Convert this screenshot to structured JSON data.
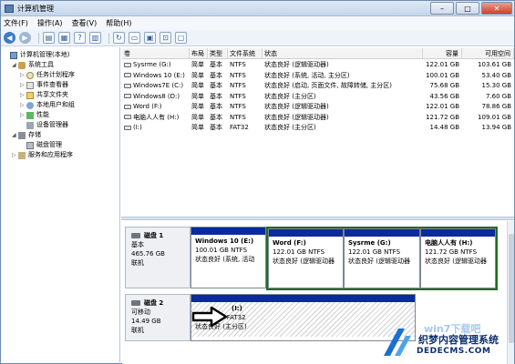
{
  "window": {
    "title": "计算机管理"
  },
  "menu": [
    "文件(F)",
    "操作(A)",
    "查看(V)",
    "帮助(H)"
  ],
  "tree": [
    {
      "label": "计算机管理(本地)",
      "level": 0,
      "exp": "",
      "icon": "computer-icon"
    },
    {
      "label": "系统工具",
      "level": 1,
      "exp": "◢",
      "icon": "tools-icon"
    },
    {
      "label": "任务计划程序",
      "level": 2,
      "exp": "▷",
      "icon": "clock-icon"
    },
    {
      "label": "事件查看器",
      "level": 2,
      "exp": "▷",
      "icon": "event-log-icon"
    },
    {
      "label": "共享文件夹",
      "level": 2,
      "exp": "▷",
      "icon": "shared-folder-icon"
    },
    {
      "label": "本地用户和组",
      "level": 2,
      "exp": "▷",
      "icon": "users-icon"
    },
    {
      "label": "性能",
      "level": 2,
      "exp": "▷",
      "icon": "performance-icon"
    },
    {
      "label": "设备管理器",
      "level": 2,
      "exp": "",
      "icon": "device-manager-icon"
    },
    {
      "label": "存储",
      "level": 1,
      "exp": "◢",
      "icon": "storage-icon"
    },
    {
      "label": "磁盘管理",
      "level": 2,
      "exp": "",
      "icon": "disk-icon"
    },
    {
      "label": "服务和应用程序",
      "level": 1,
      "exp": "▷",
      "icon": "services-icon"
    }
  ],
  "volumes": {
    "headers": [
      "卷",
      "布局",
      "类型",
      "文件系统",
      "状态",
      "容量",
      "可用空间"
    ],
    "rows": [
      [
        "Sysrme (G:)",
        "简单",
        "基本",
        "NTFS",
        "状态良好 (逻辑驱动器)",
        "122.01 GB",
        "103.61 GB"
      ],
      [
        "Windows 10 (E:)",
        "简单",
        "基本",
        "NTFS",
        "状态良好 (系统, 活动, 主分区)",
        "100.01 GB",
        "53.40 GB"
      ],
      [
        "Windows7E (C:)",
        "简单",
        "基本",
        "NTFS",
        "状态良好 (启动, 页面文件, 故障转储, 主分区)",
        "75.68 GB",
        "15.30 GB"
      ],
      [
        "Windows8 (D:)",
        "简单",
        "基本",
        "NTFS",
        "状态良好 (主分区)",
        "43.56 GB",
        "7.60 GB"
      ],
      [
        "Word (F:)",
        "简单",
        "基本",
        "NTFS",
        "状态良好 (逻辑驱动器)",
        "122.01 GB",
        "78.86 GB"
      ],
      [
        "电脑人人有 (H:)",
        "简单",
        "基本",
        "NTFS",
        "状态良好 (逻辑驱动器)",
        "121.72 GB",
        "109.01 GB"
      ],
      [
        "(I:)",
        "简单",
        "基本",
        "FAT32",
        "状态良好 (主分区)",
        "14.48 GB",
        "13.94 GB"
      ]
    ]
  },
  "disk1": {
    "name": "磁盘 1",
    "type": "基本",
    "size": "465.76 GB",
    "status": "联机",
    "partitions": [
      {
        "name": "Windows 10  (E:)",
        "size": "100.01 GB NTFS",
        "status": "状态良好 (系统, 活动"
      },
      {
        "name": "Word  (F:)",
        "size": "122.01 GB NTFS",
        "status": "状态良好 (逻辑驱动器"
      },
      {
        "name": "Sysrme  (G:)",
        "size": "122.01 GB NTFS",
        "status": "状态良好 (逻辑驱动器"
      },
      {
        "name": "电脑人人有  (H:)",
        "size": "121.72 GB NTFS",
        "status": "状态良好 (逻辑驱动器"
      }
    ]
  },
  "disk2": {
    "name": "磁盘 2",
    "type": "可移动",
    "size": "14.49 GB",
    "status": "联机",
    "partition": {
      "name": "(I:)",
      "size": "14.48 GB FAT32",
      "status": "状态良好 (主分区)"
    }
  },
  "watermark": {
    "line1": "织梦内容管理系统",
    "line2": "DEDECMS.COM",
    "faint": "win7下载吧"
  }
}
